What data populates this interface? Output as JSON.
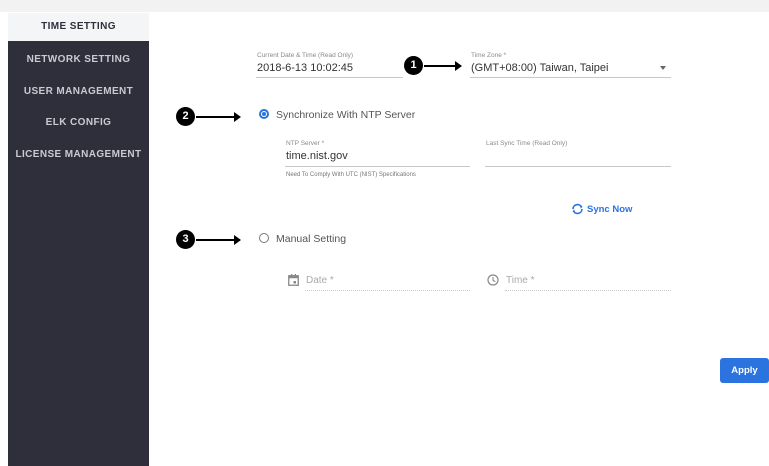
{
  "sidebar": {
    "items": [
      {
        "label": "TIME SETTING"
      },
      {
        "label": "NETWORK SETTING"
      },
      {
        "label": "USER MANAGEMENT"
      },
      {
        "label": "ELK CONFIG"
      },
      {
        "label": "LICENSE MANAGEMENT"
      }
    ],
    "active_index": 0
  },
  "markers": [
    "1",
    "2",
    "3"
  ],
  "datetime": {
    "label": "Current Date & Time (Read Only)",
    "value": "2018-6-13 10:02:45"
  },
  "timezone": {
    "label": "Time Zone *",
    "value": "(GMT+08:00) Taiwan, Taipei"
  },
  "ntp": {
    "radio_label": "Synchronize With NTP Server",
    "selected": true,
    "server_label": "NTP Server *",
    "server_value": "time.nist.gov",
    "hint": "Need To Comply With UTC (NIST) Specifications",
    "last_sync_label": "Last Sync Time (Read Only)",
    "last_sync_value": "",
    "sync_label": "Sync Now"
  },
  "manual": {
    "radio_label": "Manual Setting",
    "selected": false,
    "date_placeholder": "Date *",
    "time_placeholder": "Time *"
  },
  "apply_label": "Apply",
  "colors": {
    "sidebar_bg": "#2e2f3a",
    "accent": "#2b74e0"
  }
}
